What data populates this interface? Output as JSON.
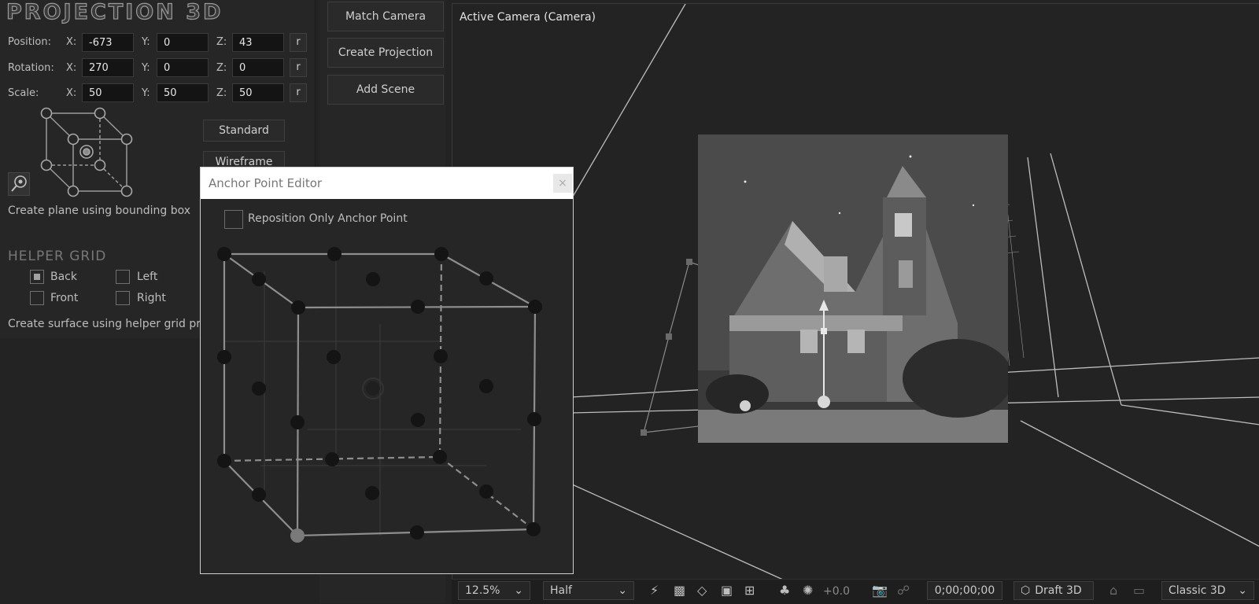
{
  "logo": "PROJECTION 3D",
  "position": {
    "label": "Position:",
    "x_label": "X:",
    "x": "-673",
    "y_label": "Y:",
    "y": "0",
    "z_label": "Z:",
    "z": "43",
    "reset": "r"
  },
  "rotation": {
    "label": "Rotation:",
    "x_label": "X:",
    "x": "270",
    "y_label": "Y:",
    "y": "0",
    "z_label": "Z:",
    "z": "0",
    "reset": "r"
  },
  "scale": {
    "label": "Scale:",
    "x_label": "X:",
    "x": "50",
    "y_label": "Y:",
    "y": "50",
    "z_label": "Z:",
    "z": "50",
    "reset": "r"
  },
  "view_buttons": {
    "standard": "Standard",
    "wireframe": "Wireframe"
  },
  "bounding_box_text": "Create plane using bounding box",
  "helper_grid": {
    "title": "HELPER GRID",
    "back": "Back",
    "back_checked": true,
    "left": "Left",
    "left_checked": false,
    "front": "Front",
    "front_checked": false,
    "right": "Right",
    "right_checked": false,
    "surface_text": "Create surface using helper grid prop"
  },
  "actions": {
    "match_camera": "Match Camera",
    "create_projection": "Create Projection",
    "add_scene": "Add Scene"
  },
  "viewer": {
    "title": "Active Camera (Camera)"
  },
  "dialog": {
    "title": "Anchor Point Editor",
    "close_icon": "close-icon",
    "reposition_label": "Reposition Only Anchor Point",
    "reposition_checked": false
  },
  "bottom_bar": {
    "zoom": "12.5%",
    "resolution": "Half",
    "exposure": "+0.0",
    "timecode": "0;00;00;00",
    "renderer_draft": "Draft 3D",
    "renderer": "Classic 3D"
  },
  "colors": {
    "panel": "#262626",
    "field": "#141414",
    "accent": "#e0e0e0"
  }
}
